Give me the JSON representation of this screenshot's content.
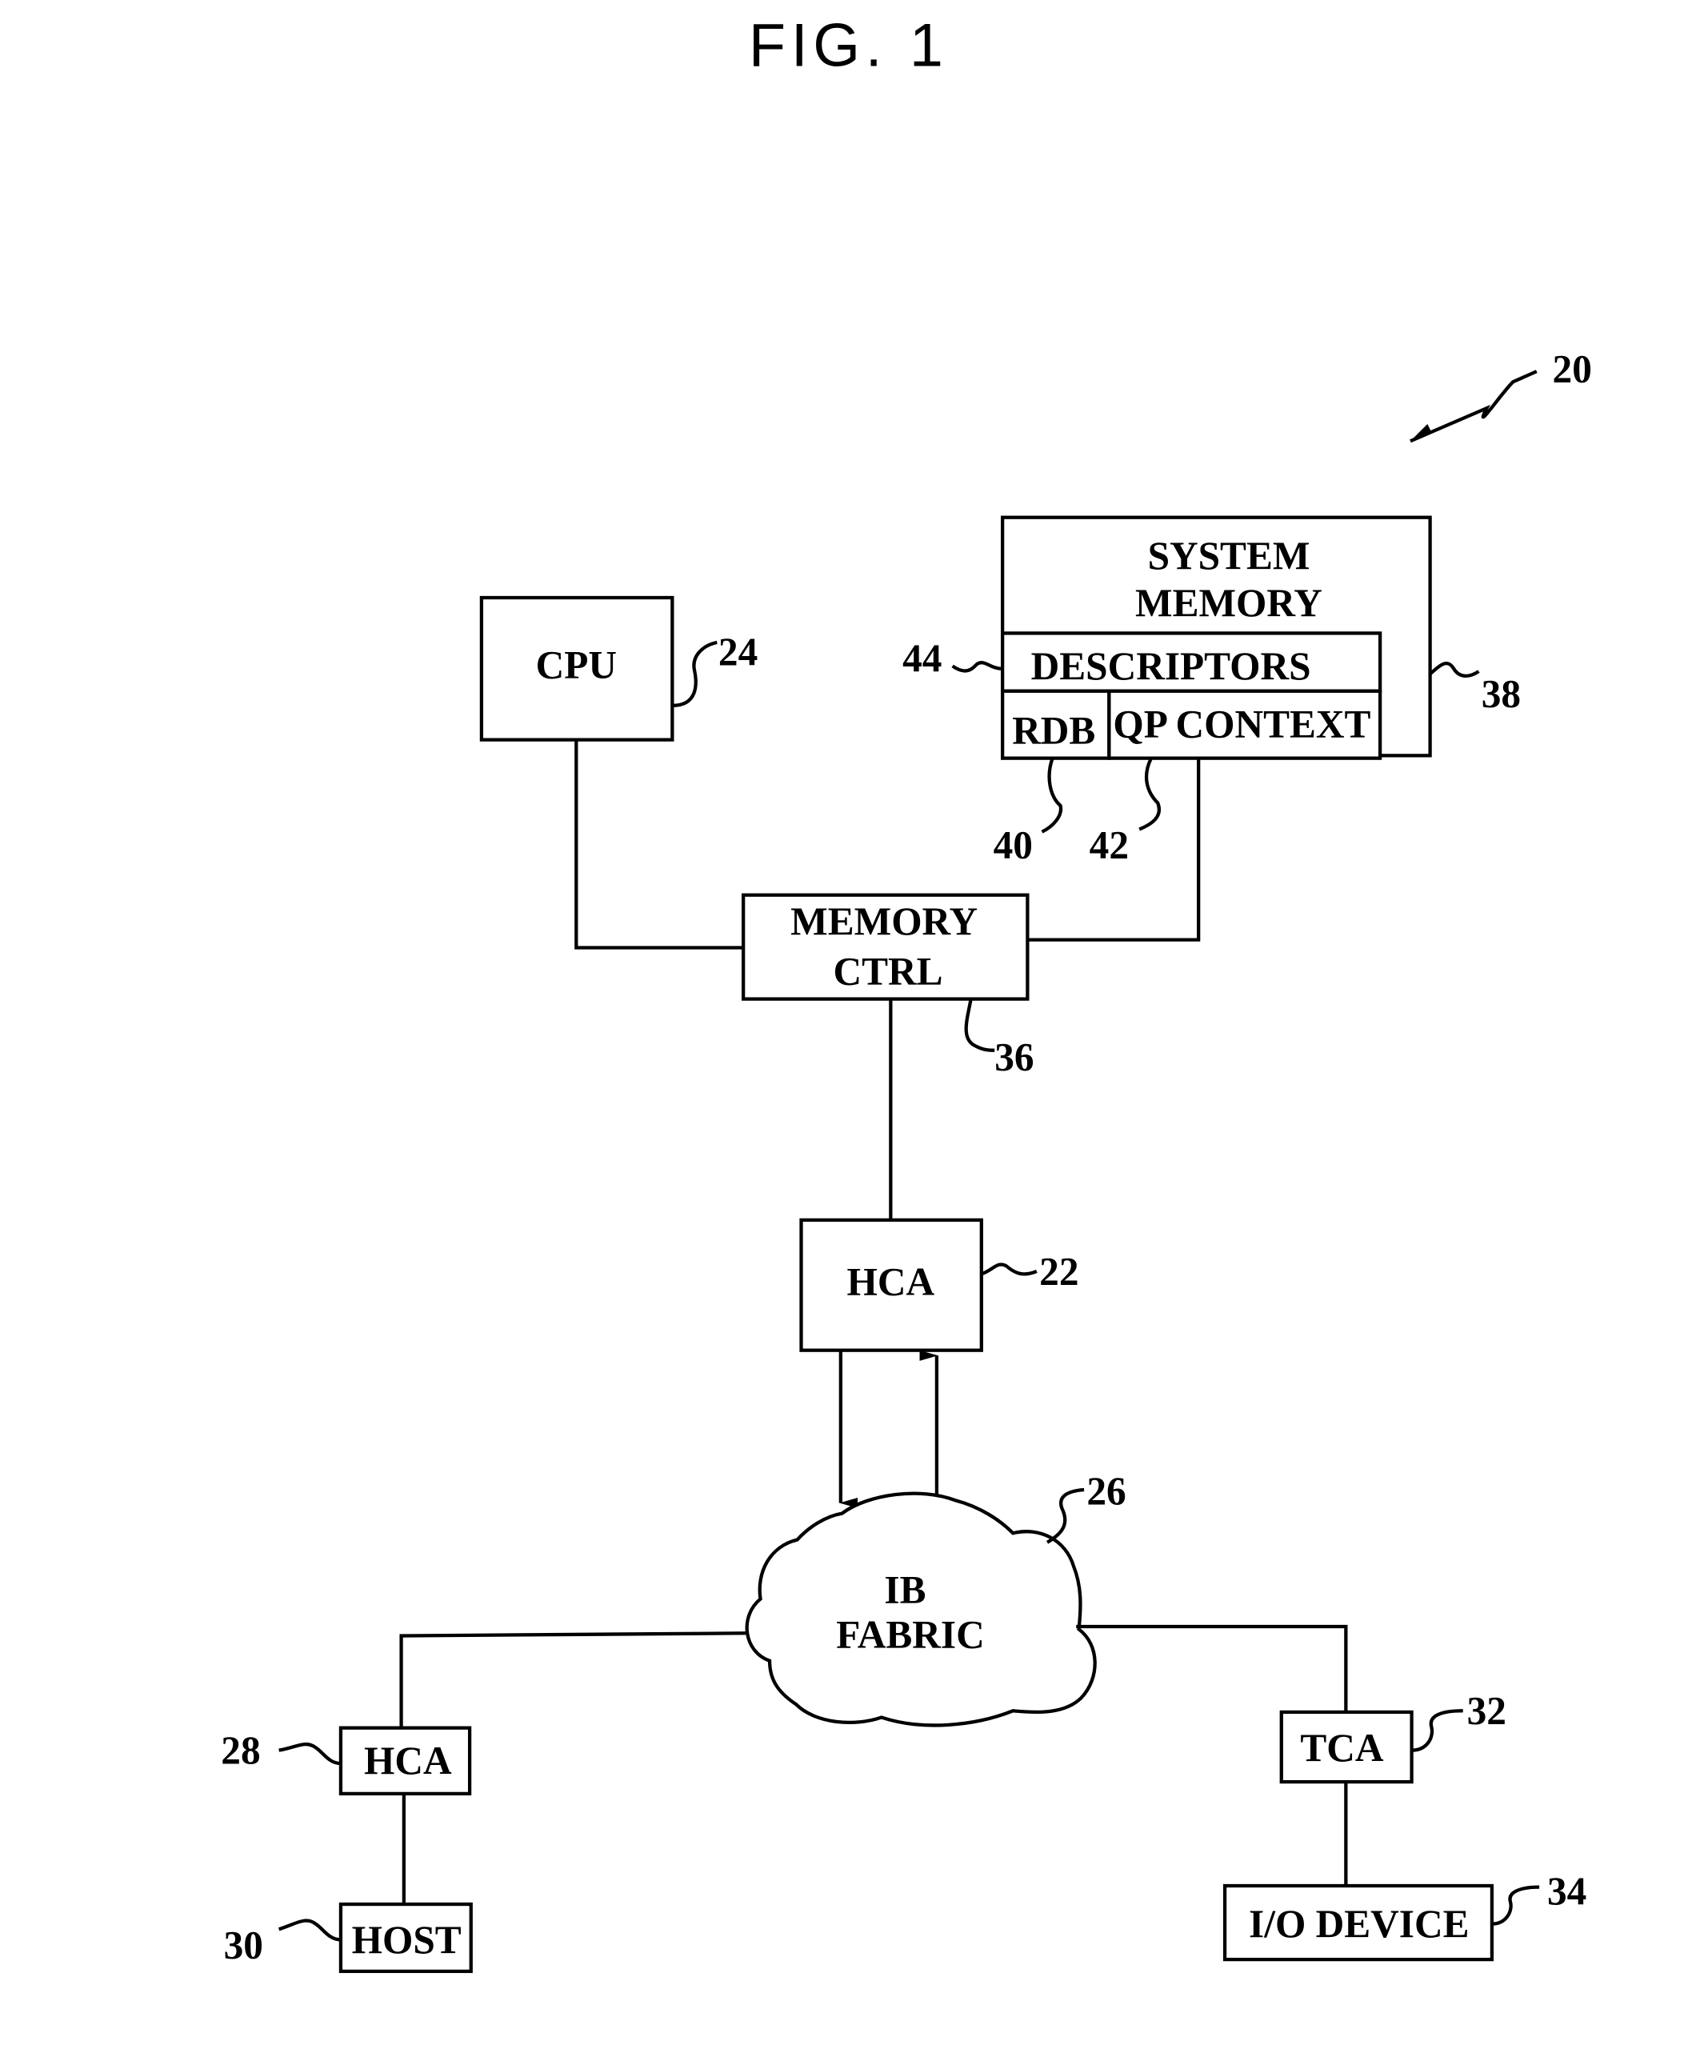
{
  "figure": {
    "title": "FIG. 1",
    "system_ref": "20"
  },
  "blocks": {
    "cpu": {
      "label": "CPU",
      "ref": "24"
    },
    "system_memory": {
      "label_line1": "SYSTEM",
      "label_line2": "MEMORY",
      "ref": "38"
    },
    "descriptors": {
      "label": "DESCRIPTORS",
      "ref": "44"
    },
    "rdb": {
      "label": "RDB",
      "ref": "40"
    },
    "qp_context": {
      "label": "QP  CONTEXT",
      "ref": "42"
    },
    "memory_ctrl": {
      "label_line1": "MEMORY",
      "label_line2": "CTRL",
      "ref": "36"
    },
    "hca_main": {
      "label": "HCA",
      "ref": "22"
    },
    "ib_fabric": {
      "label_line1": "IB",
      "label_line2": "FABRIC",
      "ref": "26"
    },
    "hca_remote": {
      "label": "HCA",
      "ref": "28"
    },
    "host": {
      "label": "HOST",
      "ref": "30"
    },
    "tca": {
      "label": "TCA",
      "ref": "32"
    },
    "io_device": {
      "label": "I/O  DEVICE",
      "ref": "34"
    }
  }
}
